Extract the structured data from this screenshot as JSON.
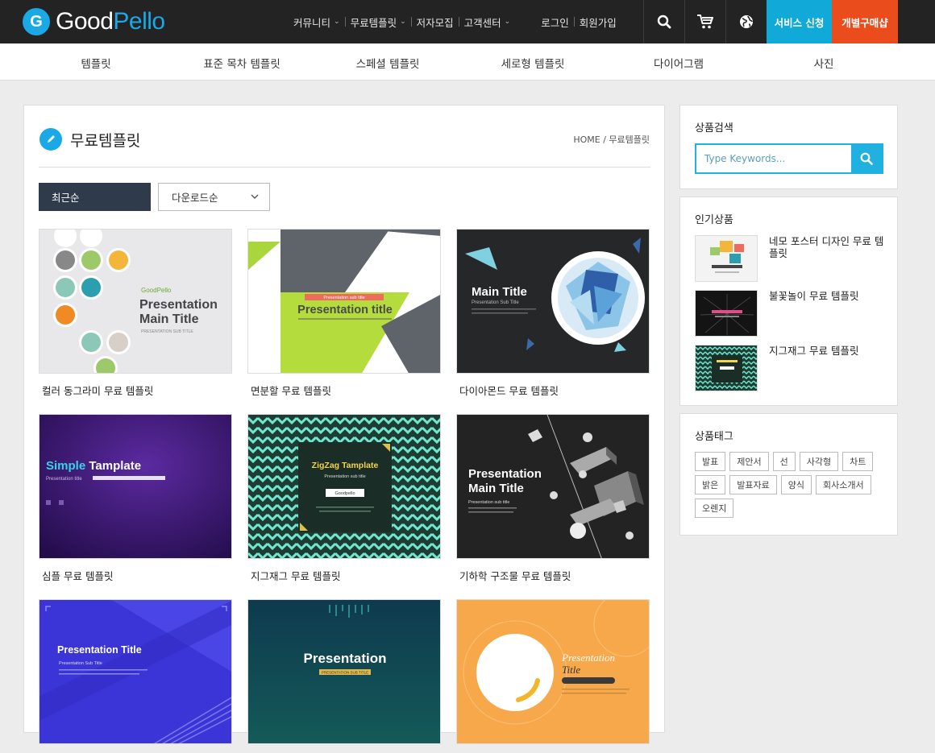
{
  "brand": {
    "good": "Good",
    "pello": "Pello",
    "mark": "G"
  },
  "topnav": {
    "community": "커뮤니티",
    "free_templates": "무료템플릿",
    "author_recruit": "저자모집",
    "customer_center": "고객센터",
    "login": "로그인",
    "signup": "회원가입",
    "service_request": "서비스 신청",
    "custom_order": "개별구매샵"
  },
  "subnav": [
    "템플릿",
    "표준 목차 템플릿",
    "스페셜 템플릿",
    "세로형 템플릿",
    "다이어그램",
    "사진"
  ],
  "main": {
    "title": "무료템플릿",
    "breadcrumb": "HOME / 무료템플릿",
    "sort_recent": "최근순",
    "sort_download": "다운로드순",
    "cards": [
      {
        "title": "컬러 동그라미 무료 템플릿",
        "thumb_brand": "GoodPello",
        "thumb_line1": "Presentation",
        "thumb_line2": "Main Title",
        "thumb_sub": "PRESENTATION SUB TITLE"
      },
      {
        "title": "면분할 무료 템플릿",
        "thumb_badge": "Presentation sub title",
        "thumb_line1": "Presentation title"
      },
      {
        "title": "다이아몬드 무료 템플릿",
        "thumb_line1": "Main Title",
        "thumb_sub": "Presentation Sub Title"
      },
      {
        "title": "심플 무료 템플릿",
        "thumb_line1a": "Simple ",
        "thumb_line1b": "Tamplate",
        "thumb_sub": "Presentation title"
      },
      {
        "title": "지그재그 무료 템플릿",
        "thumb_line1": "ZigZag Tamplate",
        "thumb_sub": "Presentation sub title",
        "thumb_btn": "Goodpello"
      },
      {
        "title": "기하학 구조물 무료 템플릿",
        "thumb_line1": "Presentation",
        "thumb_line2": "Main Title",
        "thumb_sub": "Presentation sub title"
      },
      {
        "title": "",
        "thumb_line1": "Presentation Title",
        "thumb_sub": "Presentation Sub Title"
      },
      {
        "title": "",
        "thumb_line1": "Presentation",
        "thumb_sub": "PRESENTATION SUB TITLE"
      },
      {
        "title": "",
        "thumb_line1": "Presentation",
        "thumb_line2": "Title"
      }
    ]
  },
  "sidebar": {
    "search_title": "상품검색",
    "search_placeholder": "Type Keywords...",
    "popular_title": "인기상품",
    "popular": [
      {
        "title": "네모 포스터 디자인 무료 템플릿"
      },
      {
        "title": "불꽃놀이 무료 템플릿"
      },
      {
        "title": "지그재그 무료 템플릿"
      }
    ],
    "tags_title": "상품태그",
    "tags": [
      "발표",
      "제안서",
      "선",
      "사각형",
      "차트",
      "밝은",
      "발표자료",
      "양식",
      "회사소개서",
      "오렌지"
    ]
  },
  "colors": {
    "accent": "#1aa9e6",
    "topbar": "#232323",
    "service": "#11a9d8",
    "order": "#ea4c1c",
    "sort_active": "#2f3a4a"
  }
}
